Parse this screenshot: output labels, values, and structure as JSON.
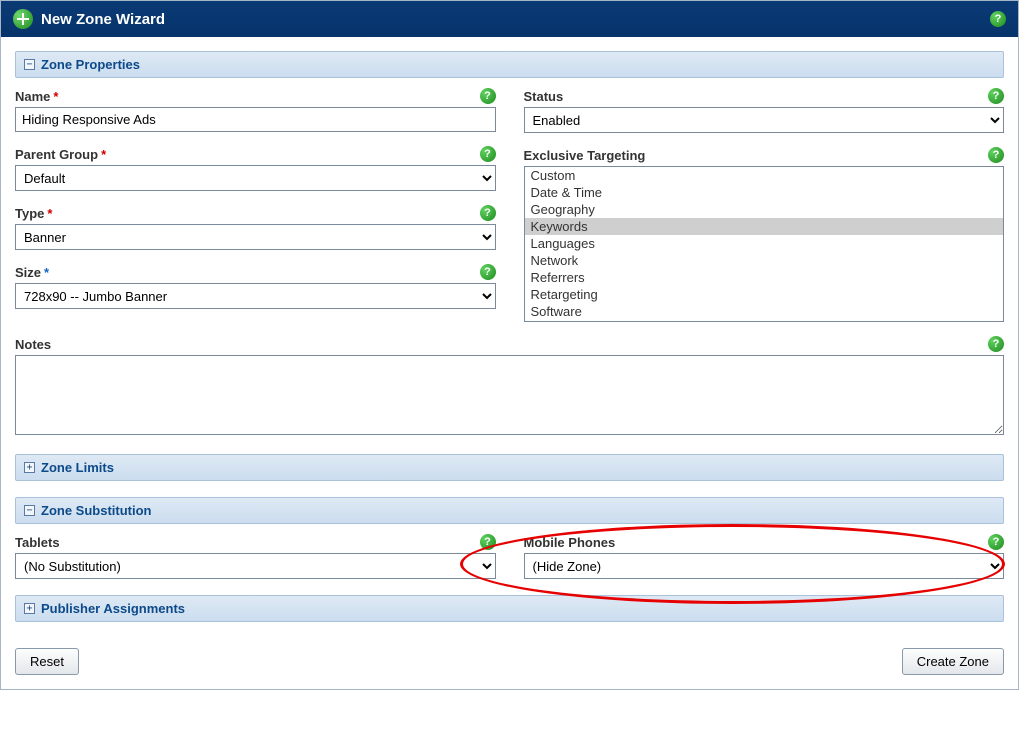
{
  "window": {
    "title": "New Zone Wizard"
  },
  "sections": {
    "properties": {
      "title": "Zone Properties",
      "collapsed": false
    },
    "limits": {
      "title": "Zone Limits",
      "collapsed": true
    },
    "substitution": {
      "title": "Zone Substitution",
      "collapsed": false
    },
    "publisher": {
      "title": "Publisher Assignments",
      "collapsed": true
    }
  },
  "fields": {
    "name": {
      "label": "Name",
      "value": "Hiding Responsive Ads"
    },
    "parent": {
      "label": "Parent Group",
      "value": "Default"
    },
    "type": {
      "label": "Type",
      "value": "Banner"
    },
    "size": {
      "label": "Size",
      "value": "728x90 -- Jumbo Banner"
    },
    "notes": {
      "label": "Notes",
      "value": ""
    },
    "status": {
      "label": "Status",
      "value": "Enabled"
    },
    "exclusive": {
      "label": "Exclusive Targeting",
      "options": [
        "Custom",
        "Date & Time",
        "Geography",
        "Keywords",
        "Languages",
        "Network",
        "Referrers",
        "Retargeting",
        "Software"
      ],
      "selected": "Keywords"
    },
    "tablets": {
      "label": "Tablets",
      "value": "(No Substitution)"
    },
    "mobile": {
      "label": "Mobile Phones",
      "value": "(Hide Zone)"
    }
  },
  "buttons": {
    "reset": "Reset",
    "create": "Create Zone"
  },
  "glyphs": {
    "help": "?",
    "minus": "−",
    "plus": "+"
  }
}
